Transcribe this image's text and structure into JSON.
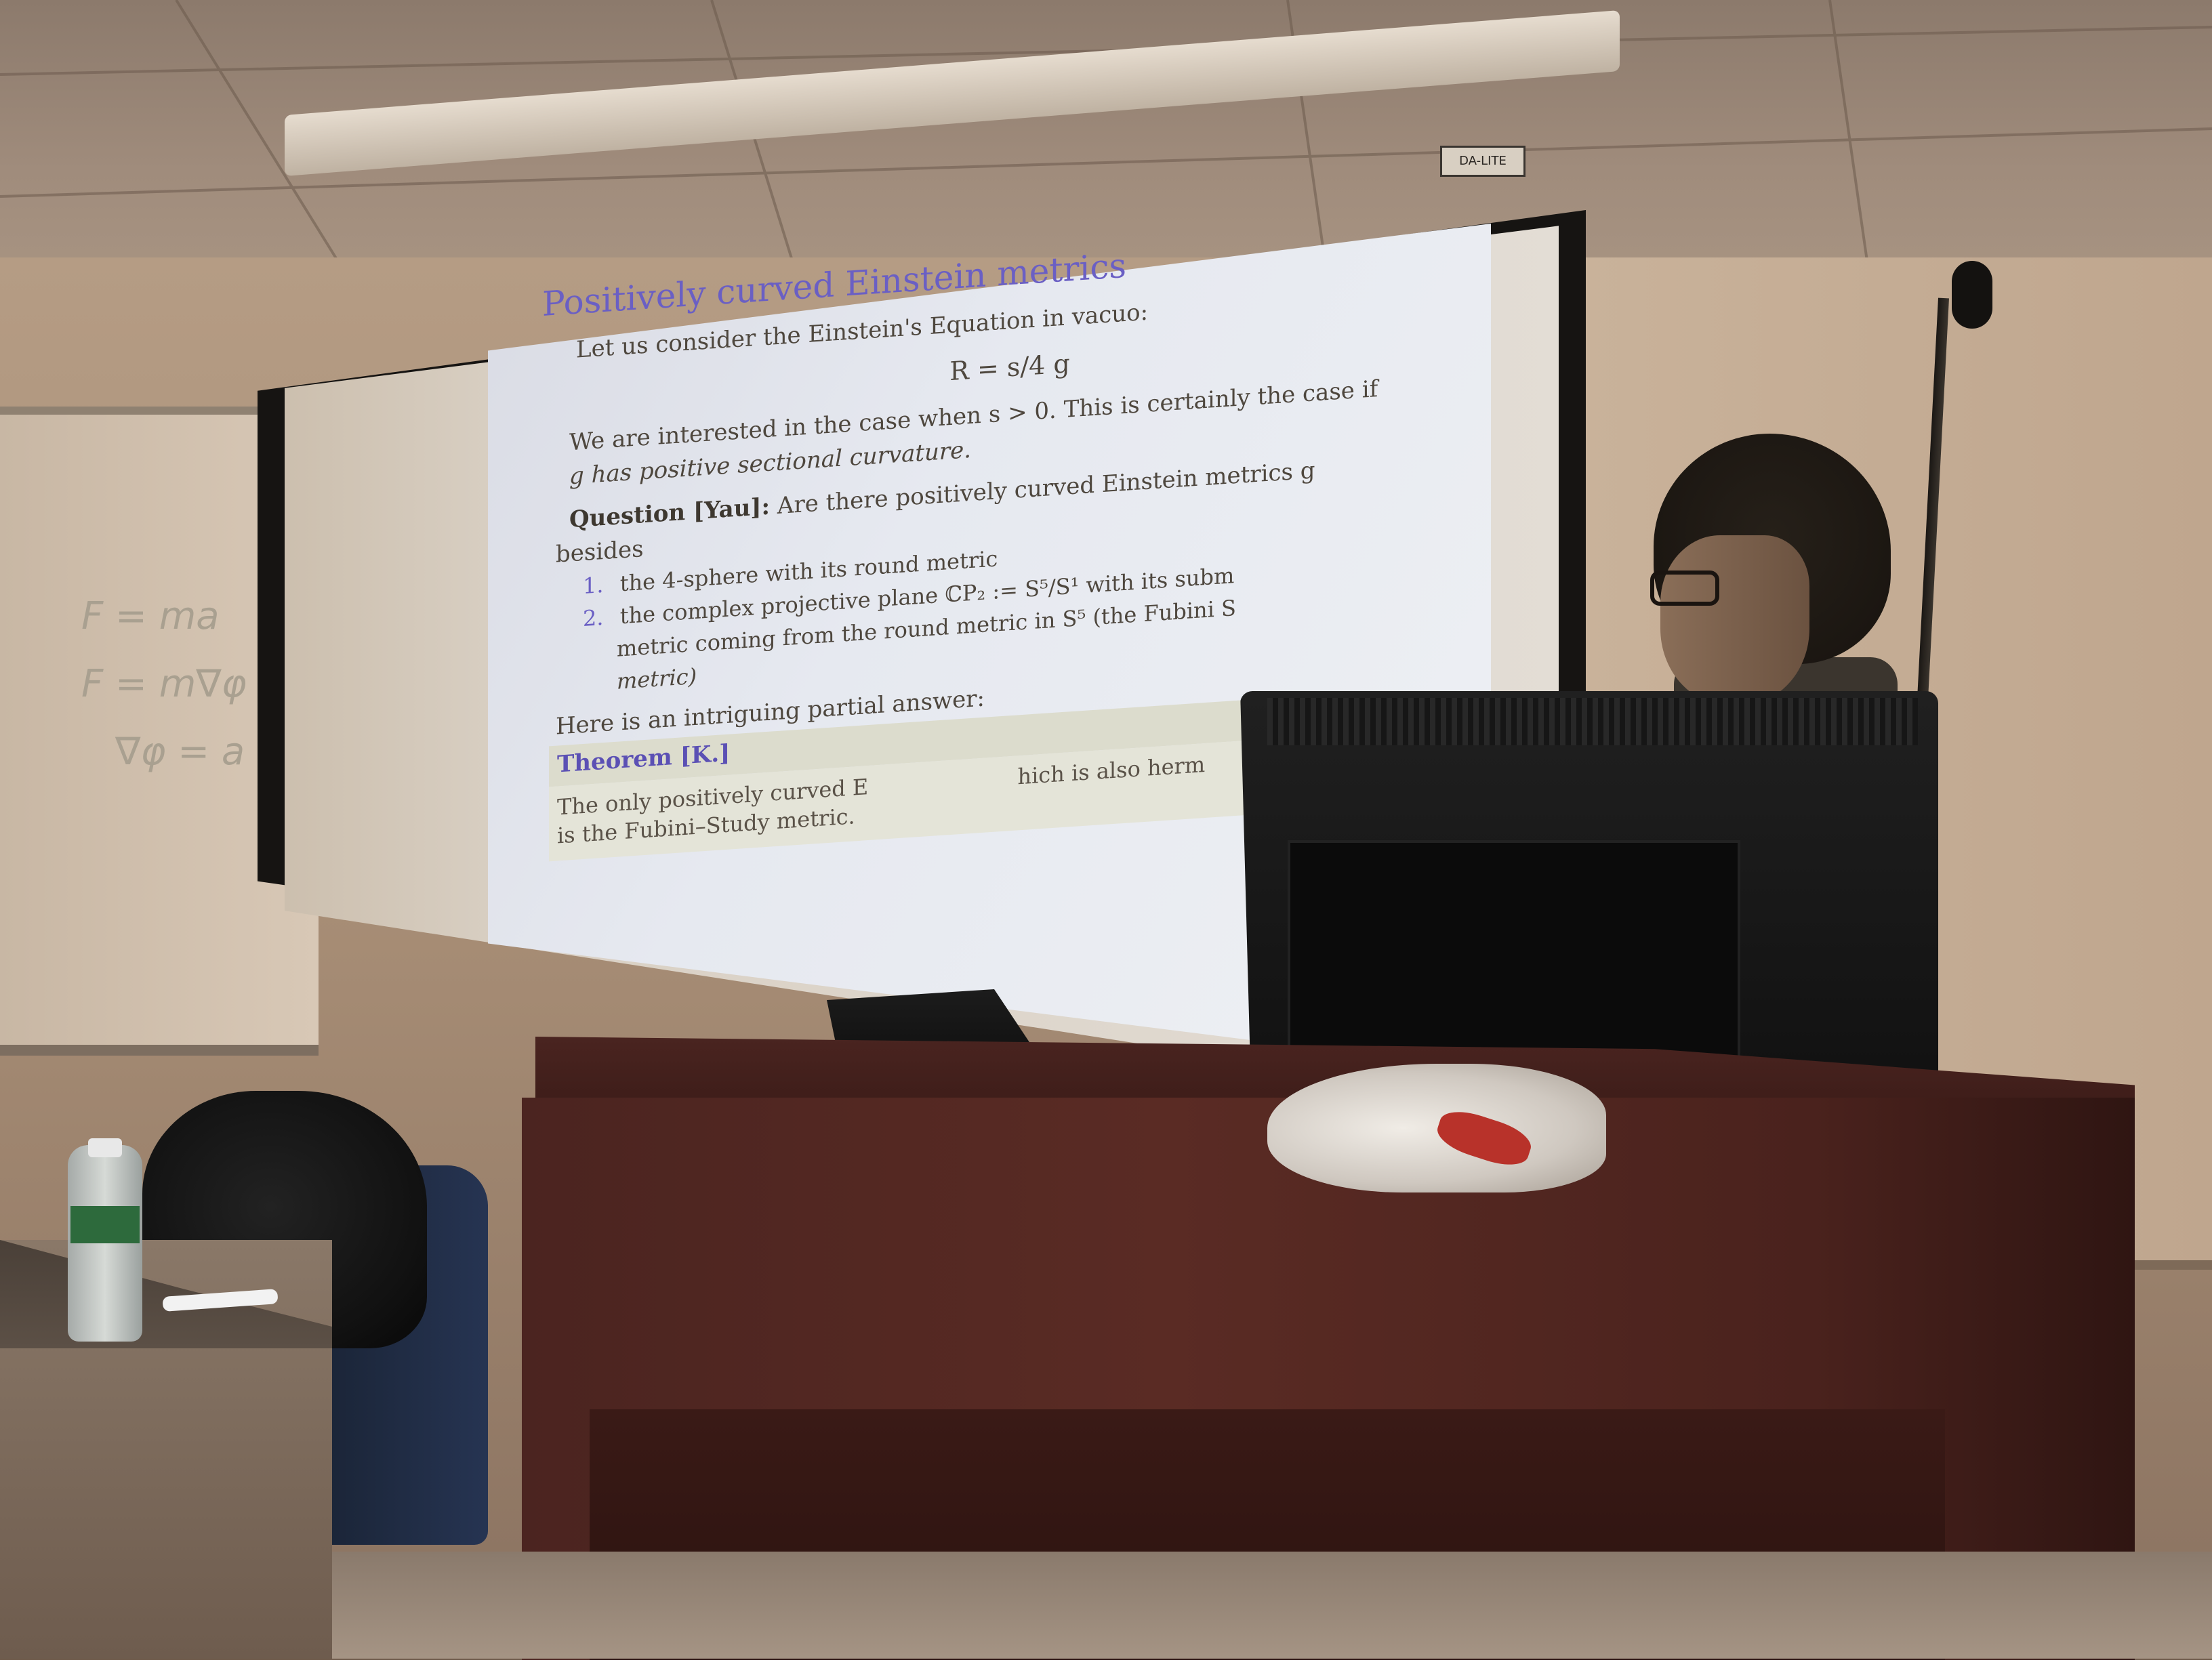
{
  "brand_label": "DA-LITE",
  "whiteboard_notes": [
    "F = ma",
    "F = m∇φ",
    "∇φ = a"
  ],
  "slide": {
    "title": "Positively curved Einstein metrics",
    "intro": "Let us consider the Einstein's Equation in vacuo:",
    "equation": "R = s/4 g",
    "interest_line1": "We are interested in the case when s > 0. This is certainly the case if",
    "interest_line2": "g has positive sectional curvature.",
    "question_label": "Question [Yau]:",
    "question_text": "Are there positively curved Einstein metrics g",
    "question_cont": "besides",
    "items": [
      {
        "num": "1.",
        "text": "the 4-sphere with its round metric"
      },
      {
        "num": "2.",
        "text": "the complex projective plane ℂP₂ := S⁵/S¹ with its subm"
      }
    ],
    "item2_cont1": "metric coming from the round metric in S⁵ (the Fubini S",
    "item2_cont2": "metric)",
    "partial_answer": "Here is an intriguing partial answer:",
    "theorem_title": "Theorem [K.]",
    "theorem_line1": "The only positively curved E",
    "theorem_line1_right": "hich is also herm",
    "theorem_line2": "is the Fubini–Study metric."
  }
}
